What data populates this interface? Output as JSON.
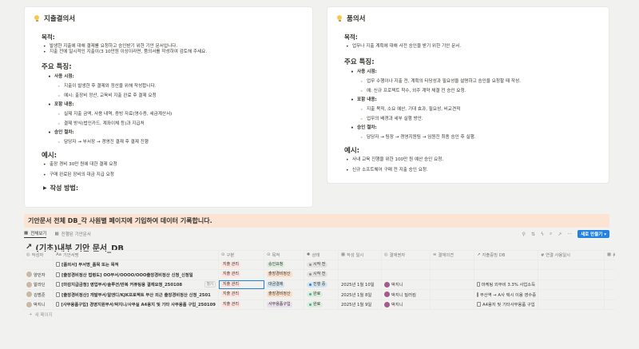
{
  "left_card": {
    "title": "지출결의서",
    "purpose_heading": "목적:",
    "purpose_items": [
      "발생한 지출에 대해 결제를 요청하고 승인받기 위한 기안 문서입니다.",
      "지출 전에 일시적인 지출이(3 10만원 이상이라면, 품의서를 작성하여 검토해 주세요."
    ],
    "features_heading": "주요 특징:",
    "features": [
      {
        "label": "사용 시점:",
        "children": [
          "지출이 발생한 후 결제와 정산을 위해 작성합니다.",
          "예시: 출장비 정산, 교육비 지출 완료 후 결제 요청"
        ]
      },
      {
        "label": "포함 내용:",
        "children": [
          "실제 지출 금액, 사용 내역, 증빙 자료(영수증, 세금계산서)",
          "결제 방식(법인카드, 계좌이체 등)과 지급처"
        ]
      },
      {
        "label": "승인 절차:",
        "children": [
          "담당자 → 부서장 → 경영진 결재 후 결제 진행"
        ]
      }
    ],
    "examples_heading": "예시:",
    "examples": [
      "출장 경비 30만 원에 대한 결제 요청",
      "구매 완료된 장비의 대금 지급 요청"
    ],
    "toggle_label": "작성 방법:"
  },
  "right_card": {
    "title": "품의서",
    "purpose_heading": "목적:",
    "purpose_items": [
      "업무나 지출 계획에 대해 사전 승인을 받기 위한 기안 문서."
    ],
    "features_heading": "주요 특징:",
    "features": [
      {
        "label": "사용 시점:",
        "children": [
          "업무 수행이나 지출 전, 계획의 타당성과 필요성을 설명하고 승인을 요청할 때 작성.",
          "예: 신규 프로젝트 착수, 외주 계약 체결 전 승인 요청."
        ]
      },
      {
        "label": "포함 내용:",
        "children": [
          "지출 목적, 소요 예산, 기대 효과, 필요성, 비교견적",
          "업무의 배경과 세부 실행 방안."
        ]
      },
      {
        "label": "승인 절차:",
        "children": [
          "담당자 → 팀장 → 경영지원팀 → 임원진 최종 승인 후 실행."
        ]
      }
    ],
    "examples_heading": "예시:",
    "examples": [
      "사내 교육 진행을 위한 100만 원 예산 승인 요청.",
      "신규 소프트웨어 구매 전 지출 승인 요청."
    ]
  },
  "callout": "기안문서 전체 DB_각 사원별 페이지에 기입하여 데이터 기록합니다.",
  "tabs": [
    {
      "label": "전체보기",
      "active": true
    },
    {
      "label": "진행된 기안문서",
      "active": false
    }
  ],
  "new_button": "새로 만들기",
  "db_title": "(기초)내부 기안 문서_DB",
  "columns": [
    "작성자",
    "기안서명",
    "구분",
    "목적",
    "상태",
    "작성 일시",
    "결재권자",
    "결재의견",
    "지출증빙 DB",
    "# 연결 사용일시",
    "휴가신청기간"
  ],
  "rows": [
    {
      "author": "",
      "title": "[품의서] 부서명_품목 또는 목적",
      "type": "지출 관리",
      "purpose": "승인요청",
      "purpose_color": "#dbeddb",
      "status": "시작 전",
      "status_color": "#e3e2e0",
      "dot": "#91918e",
      "date": "",
      "approver": "",
      "evidence": "",
      "open": false,
      "sel": false
    },
    {
      "author": "양민자",
      "title": "[출장경비정산 법령도] OO부서/OOOO/OOO출장경비정산 신청_신청일",
      "type": "지출 관리",
      "purpose": "출장경비정산",
      "purpose_color": "#fadec9",
      "status": "시작 전",
      "status_color": "#e3e2e0",
      "dot": "#91918e",
      "date": "",
      "approver": "",
      "evidence": "",
      "open": false,
      "sel": false
    },
    {
      "author": "알라딘",
      "title": "[마감지급금청] 영업부서/솔루션/반복 커퓨팅용 결재요청_250108",
      "type": "지출 관리",
      "purpose": "대금결제",
      "purpose_color": "#d3e5ef",
      "status": "진행 중",
      "status_color": "#d3e5ef",
      "dot": "#2383e2",
      "date": "2025년 1월 10일",
      "approver": "박지니",
      "evidence": "마케팅 외부비 3.3% 사업소득",
      "open": true,
      "sel": true
    },
    {
      "author": "김범준",
      "title": "[출장경비정산] 개발부서/알앤디/KJK프로젝트 부산 외근 출장경비정산 신청_2501",
      "type": "지출 관리",
      "purpose": "출장경비정산",
      "purpose_color": "#fadec9",
      "status": "완료",
      "status_color": "#dbeddb",
      "dot": "#4dab9a",
      "date": "2025년 1월 8일",
      "approver": "박지니  밀러킴",
      "evidence": "부산역 → A사 택시 이용 영수증",
      "open": false,
      "sel": false
    },
    {
      "author": "박지니",
      "title": "[사무용품구입] 경영지원부서/박지니/사무실 A4용지 및 기타 사무용품 구입_250109",
      "type": "지출 관리",
      "purpose": "사무용품구입",
      "purpose_color": "#e8deee",
      "status": "완료",
      "status_color": "#dbeddb",
      "dot": "#4dab9a",
      "date": "2025년 1월 9일",
      "approver": "박지니",
      "evidence": "A4용지 및 기타사무용품 구입",
      "open": false,
      "sel": false
    }
  ],
  "open_label": "열기",
  "add_row": "새 페이지"
}
